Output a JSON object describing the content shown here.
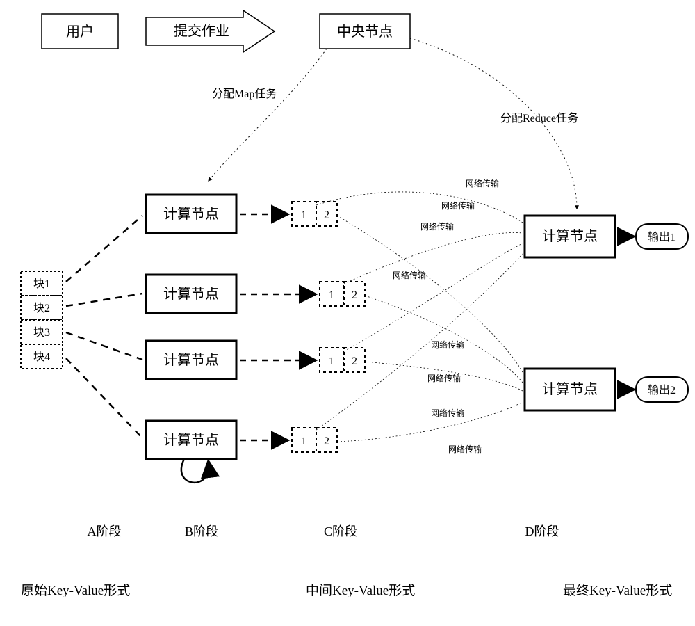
{
  "top": {
    "user": "用户",
    "submit": "提交作业",
    "central": "中央节点"
  },
  "tasks": {
    "map": "分配Map任务",
    "reduce": "分配Reduce任务"
  },
  "blocks": [
    "块1",
    "块2",
    "块3",
    "块4"
  ],
  "compute_node": "计算节点",
  "partition_labels": [
    "1",
    "2"
  ],
  "net_label": "网络传输",
  "outputs": [
    "输出1",
    "输出2"
  ],
  "phases": {
    "a": "A阶段",
    "b": "B阶段",
    "c": "C阶段",
    "d": "D阶段"
  },
  "kv": {
    "orig": "原始Key-Value形式",
    "mid": "中间Key-Value形式",
    "final": "最终Key-Value形式"
  }
}
